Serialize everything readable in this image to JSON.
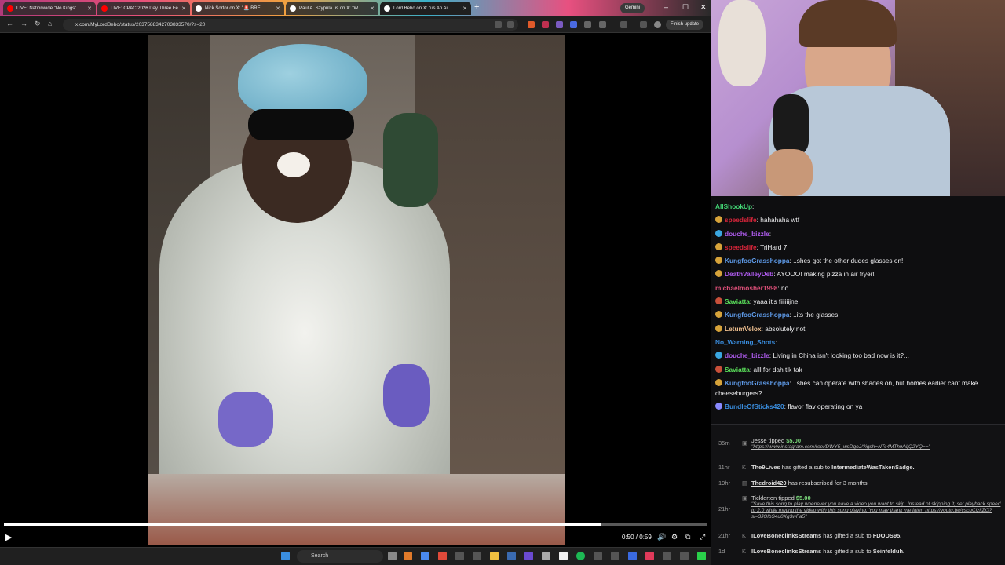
{
  "browser": {
    "tabs": [
      {
        "title": "LIVE: Nationwide \"No Kings\"",
        "favicon_color": "#ff0000"
      },
      {
        "title": "LIVE: CPAC 2026 Day Three Fe...",
        "favicon_color": "#ff0000"
      },
      {
        "title": "Nick Sortor on X: \"🚨 BRE...",
        "favicon_color": "#ffffff"
      },
      {
        "title": "Paul A. Szypula us on X: \"W...",
        "favicon_color": "#ffffff"
      },
      {
        "title": "Lord Bebo on X: \"us An Ai...",
        "favicon_color": "#ffffff"
      }
    ],
    "new_tab": "+",
    "gemini_label": "Gemini",
    "url": "x.com/MyLordBebo/status/2037588342703833570/?s=20",
    "finish_update": "Finish update"
  },
  "video": {
    "progress": 0.85,
    "time_display": "0:50 / 0:59"
  },
  "taskbar": {
    "search_label": "Search"
  },
  "chat": {
    "messages": [
      {
        "user": "AllShookUp",
        "text": "",
        "color": "#43d675",
        "badge": ""
      },
      {
        "user": "speedslife",
        "text": "hahahaha wtf",
        "color": "#d8253a",
        "badge": "#d7a33a"
      },
      {
        "user": "douche_bizzle",
        "text": "",
        "color": "#b05cf0",
        "badge": "#3aa6e0"
      },
      {
        "user": "speedslife",
        "text": "TriHard 7",
        "color": "#d8253a",
        "badge": "#d7a33a"
      },
      {
        "user": "KungfooGrasshoppa",
        "text": "..shes got the other dudes glasses on!",
        "color": "#5e9ae8",
        "badge": "#d7a33a"
      },
      {
        "user": "DeathValleyDeb",
        "text": "AYOOO! making pizza in air fryer!",
        "color": "#b05cf0",
        "badge": "#d7a33a"
      },
      {
        "user": "michaelmosher1998",
        "text": "no",
        "color": "#e0507a",
        "badge": ""
      },
      {
        "user": "Saviatta",
        "text": "yaaa it's fiiiiiijne",
        "color": "#5be05b",
        "badge": "#c8503a"
      },
      {
        "user": "KungfooGrasshoppa",
        "text": "..its the glasses!",
        "color": "#5e9ae8",
        "badge": "#d7a33a"
      },
      {
        "user": "LetumVelox",
        "text": "absolutely not.",
        "color": "#f0c090",
        "badge": "#d7a33a"
      },
      {
        "user": "No_Warning_Shots",
        "text": "",
        "color": "#3a8ee0",
        "badge": ""
      },
      {
        "user": "douche_bizzle",
        "text": "Living in China isn't looking too bad now is it?...",
        "color": "#b05cf0",
        "badge": "#3aa6e0"
      },
      {
        "user": "Saviatta",
        "text": "alll for dah tik tak",
        "color": "#5be05b",
        "badge": "#c8503a"
      },
      {
        "user": "KungfooGrasshoppa",
        "text": "..shes can operate with shades on, but homes earlier cant make cheeseburgers?",
        "color": "#5e9ae8",
        "badge": "#d7a33a",
        "wrap": true
      },
      {
        "user": "BundleOfSticks420",
        "text": "flavor flav operating on ya",
        "color": "#3a8ee0",
        "badge": "#8a8aff"
      }
    ]
  },
  "events": [
    {
      "age": "35m",
      "user": "Jesse",
      "action": "tipped",
      "amount": "$5.00",
      "note": "\"https://www.instagram.com/reel/DWY5_wsDgoJ/?igsh=NTc4MThwNjQ2YQ==\""
    },
    {
      "age": "11hr",
      "user": "The9Lives",
      "action": "has gifted a sub to",
      "target": "IntermediateWasTakenSadge."
    },
    {
      "age": "19hr",
      "user": "Thedroid420",
      "action": "has resubscribed for 3 months"
    },
    {
      "age": "21hr",
      "user": "Ticklerton",
      "action": "tipped",
      "amount": "$5.00",
      "note": "\"Save this song to play whenever you have a video you want to skip. Instead of skipping it, set playback speed to 2.0 while muting the video with this song playing. You may thank me later: https://youtu.be/cscuCizltZO?si=3JOlbS4u0Xg3wFa5\""
    },
    {
      "age": "21hr",
      "user": "ILoveBoneclinksStreams",
      "action": "has gifted a sub to",
      "target": "FDODS95."
    },
    {
      "age": "1d",
      "user": "ILoveBoneclinksStreams",
      "action": "has gifted a sub to",
      "target": "Seinfelduh."
    }
  ]
}
